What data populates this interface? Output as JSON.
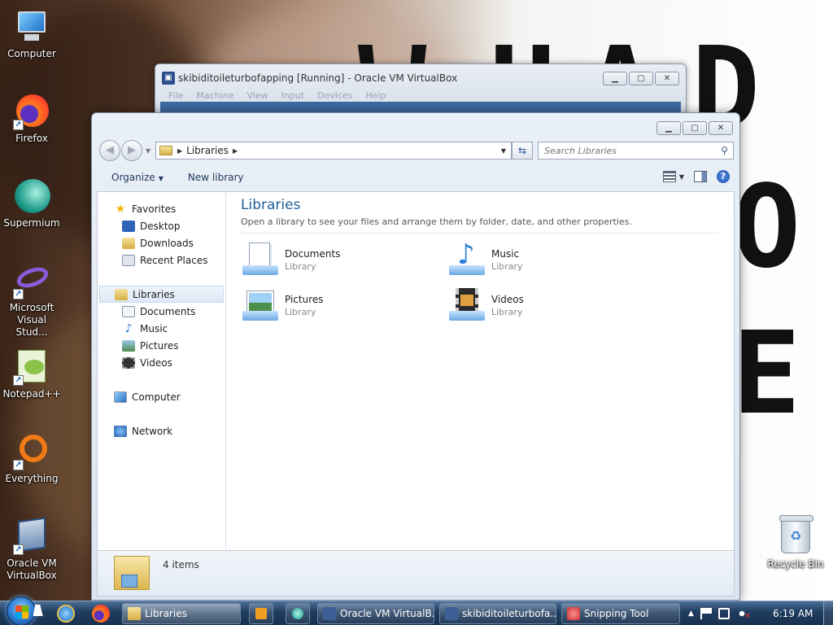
{
  "desktop": {
    "background_text": [
      "W",
      "H",
      "A",
      "D",
      "O",
      "E"
    ],
    "icons": [
      {
        "label": "Computer"
      },
      {
        "label": "Firefox"
      },
      {
        "label": "Supermium"
      },
      {
        "label": "Microsoft Visual Stud..."
      },
      {
        "label": "Notepad++"
      },
      {
        "label": "Everything"
      },
      {
        "label": "Oracle VM VirtualBox"
      }
    ],
    "recycle_bin": {
      "label": "Recycle Bin"
    }
  },
  "vbox_window": {
    "title": "skibiditoileturbofapping [Running] - Oracle VM VirtualBox",
    "menu": [
      "File",
      "Machine",
      "View",
      "Input",
      "Devices",
      "Help"
    ]
  },
  "explorer": {
    "address": {
      "crumb": "Libraries"
    },
    "search": {
      "placeholder": "Search Libraries"
    },
    "toolbar": {
      "organize": "Organize",
      "new_library": "New library"
    },
    "sidebar": {
      "favorites": {
        "label": "Favorites",
        "items": [
          "Desktop",
          "Downloads",
          "Recent Places"
        ]
      },
      "libraries": {
        "label": "Libraries",
        "items": [
          "Documents",
          "Music",
          "Pictures",
          "Videos"
        ]
      },
      "computer": "Computer",
      "network": "Network"
    },
    "content": {
      "title": "Libraries",
      "description": "Open a library to see your files and arrange them by folder, date, and other properties.",
      "items": [
        {
          "name": "Documents",
          "type": "Library",
          "icon": "documents-library-icon"
        },
        {
          "name": "Music",
          "type": "Library",
          "icon": "music-library-icon"
        },
        {
          "name": "Pictures",
          "type": "Library",
          "icon": "pictures-library-icon"
        },
        {
          "name": "Videos",
          "type": "Library",
          "icon": "videos-library-icon"
        }
      ]
    },
    "details": {
      "count": "4 items"
    }
  },
  "taskbar": {
    "tasks": [
      {
        "label": "Libraries",
        "icon": "folder-icon"
      },
      {
        "label": "Oracle VM VirtualB...",
        "icon": "virtualbox-icon"
      },
      {
        "label": "skibiditoileturbofa...",
        "icon": "virtualbox-icon"
      },
      {
        "label": "Snipping Tool",
        "icon": "scissors-icon"
      }
    ],
    "clock": "6:19 AM"
  }
}
